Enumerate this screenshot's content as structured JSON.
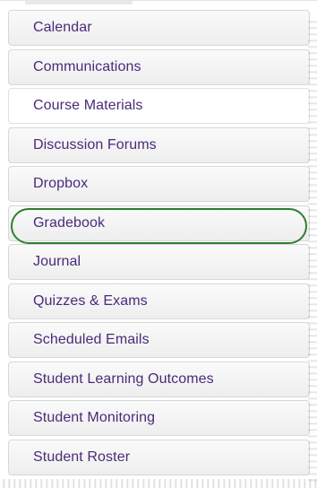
{
  "menu": {
    "items": [
      {
        "label": "Calendar"
      },
      {
        "label": "Communications"
      },
      {
        "label": "Course Materials"
      },
      {
        "label": "Discussion Forums"
      },
      {
        "label": "Dropbox"
      },
      {
        "label": "Gradebook"
      },
      {
        "label": "Journal"
      },
      {
        "label": "Quizzes & Exams"
      },
      {
        "label": "Scheduled Emails"
      },
      {
        "label": "Student Learning Outcomes"
      },
      {
        "label": "Student Monitoring"
      },
      {
        "label": "Student Roster"
      }
    ],
    "active_index": 2,
    "highlighted_index": 5
  },
  "colors": {
    "label_text": "#4a2a7a",
    "highlight_ring": "#2f7f2f",
    "item_border": "#d7d7d7",
    "item_background": "#eeeeee"
  }
}
